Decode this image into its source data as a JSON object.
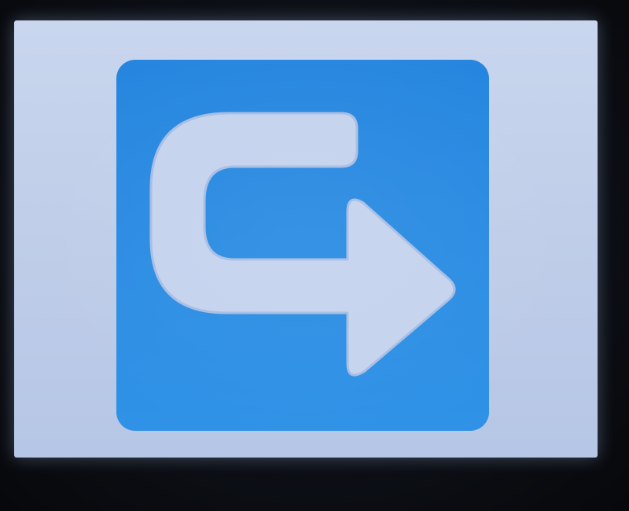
{
  "screen": {
    "background_color": "#c3d1ec"
  },
  "icon": {
    "name": "redirect-arrow-icon",
    "tile_color": "#2a8ce3",
    "arrow_color": "#c5d3ee"
  }
}
